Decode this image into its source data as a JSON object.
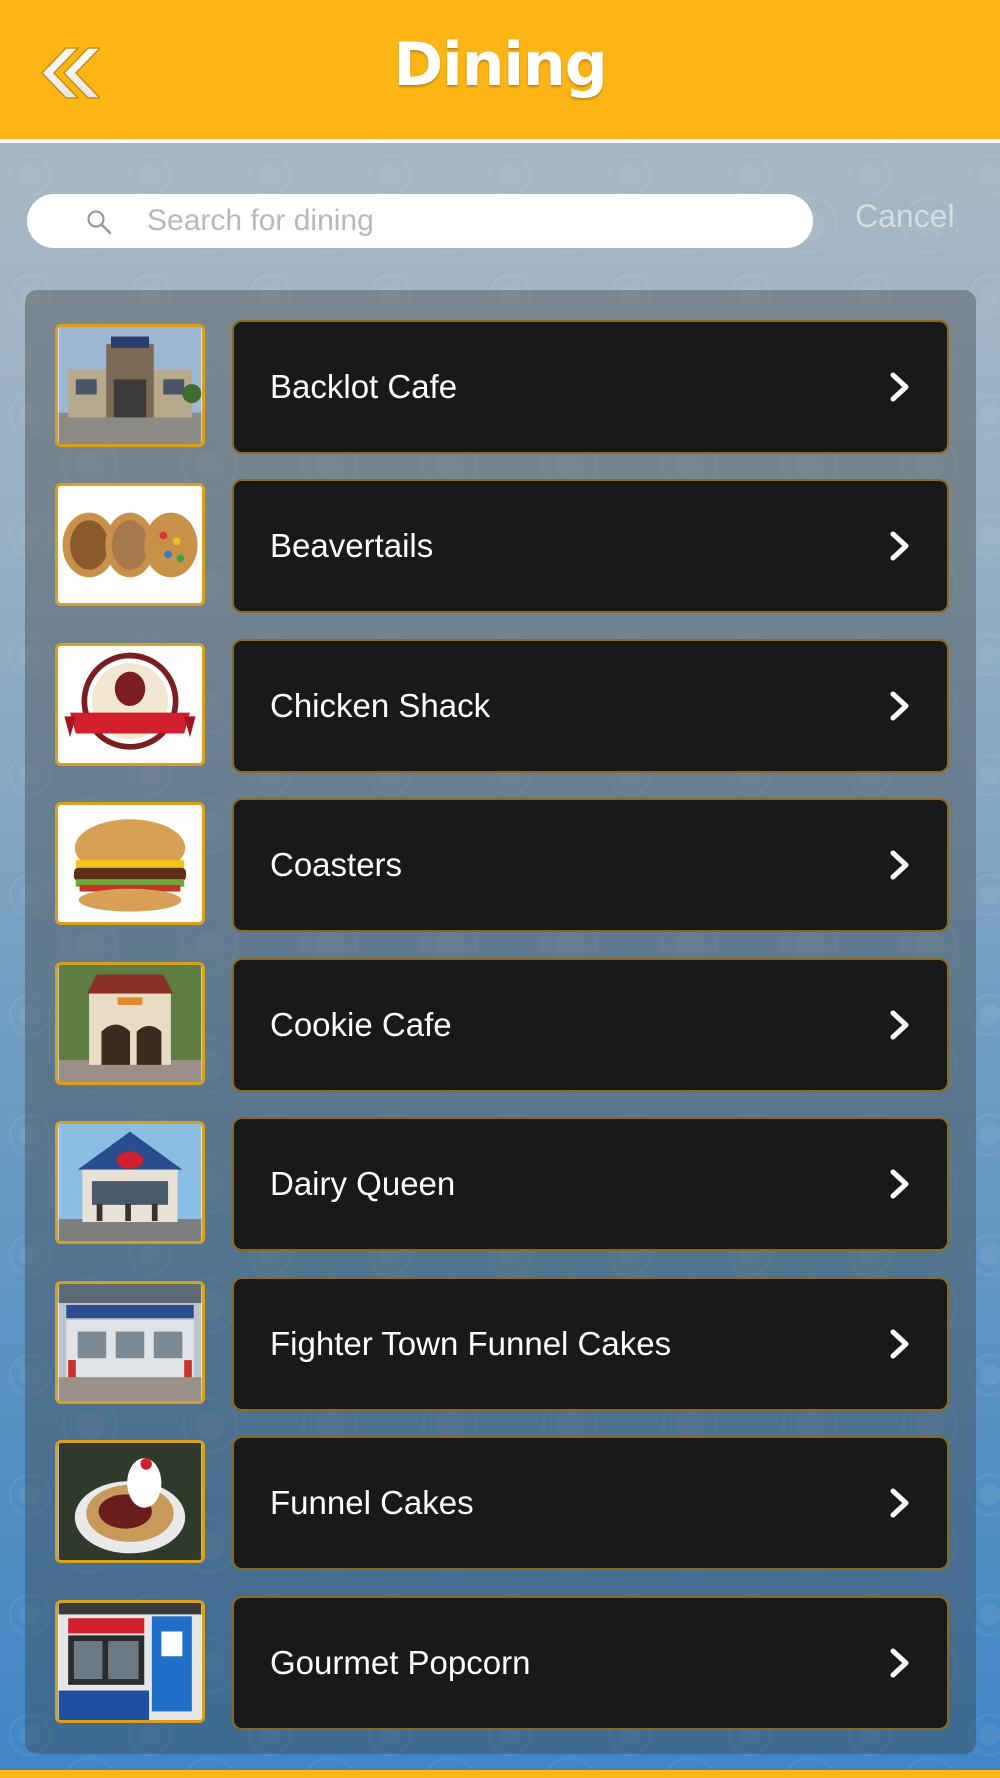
{
  "header": {
    "title": "Dining",
    "back_icon": "double-chevron-left-icon"
  },
  "search": {
    "placeholder": "Search for dining",
    "value": "",
    "cancel_label": "Cancel",
    "icon": "search-icon"
  },
  "colors": {
    "header": "#FDB515",
    "row_background": "#18191b",
    "row_border": "#8a6a1a",
    "thumb_border": "#D9A01E"
  },
  "items": [
    {
      "label": "Backlot Cafe",
      "thumb": "building-photo"
    },
    {
      "label": "Beavertails",
      "thumb": "pastry-photo"
    },
    {
      "label": "Chicken Shack",
      "thumb": "chicken-shack-logo"
    },
    {
      "label": "Coasters",
      "thumb": "burger-photo"
    },
    {
      "label": "Cookie Cafe",
      "thumb": "kiosk-photo"
    },
    {
      "label": "Dairy Queen",
      "thumb": "stand-photo"
    },
    {
      "label": "Fighter Town Funnel Cakes",
      "thumb": "storefront-photo"
    },
    {
      "label": "Funnel Cakes",
      "thumb": "funnel-cake-photo"
    },
    {
      "label": "Gourmet Popcorn",
      "thumb": "popcorn-shop-photo"
    }
  ]
}
